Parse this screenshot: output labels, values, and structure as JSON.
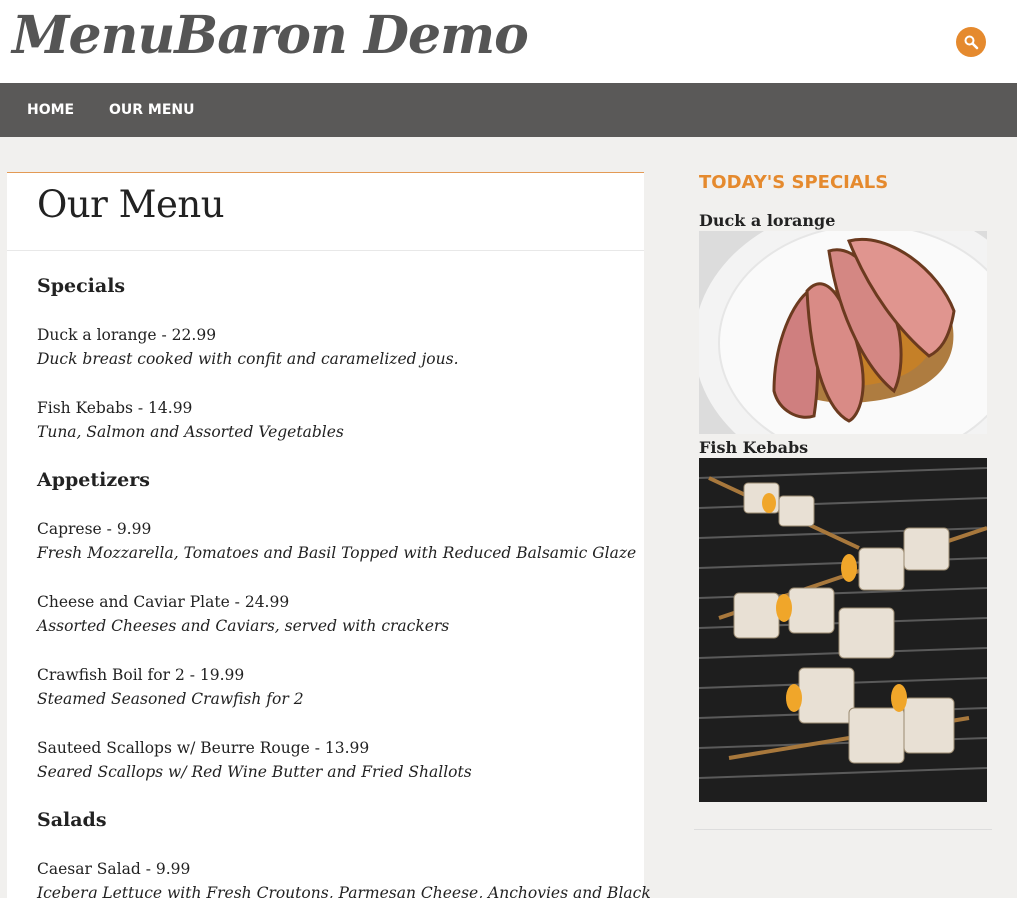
{
  "header": {
    "site_title": "MenuBaron Demo",
    "search_icon": "search-icon",
    "accent_color": "#e58a2e"
  },
  "nav": {
    "items": [
      {
        "label": "HOME"
      },
      {
        "label": "OUR MENU"
      }
    ]
  },
  "main": {
    "page_title": "Our Menu",
    "sections": [
      {
        "heading": "Specials",
        "items": [
          {
            "name": "Duck a lorange - 22.99",
            "description": "Duck breast cooked with confit and caramelized jous."
          },
          {
            "name": "Fish Kebabs - 14.99",
            "description": "Tuna, Salmon and Assorted Vegetables"
          }
        ]
      },
      {
        "heading": "Appetizers",
        "items": [
          {
            "name": "Caprese - 9.99",
            "description": "Fresh Mozzarella, Tomatoes and Basil Topped with Reduced Balsamic Glaze"
          },
          {
            "name": "Cheese and Caviar Plate - 24.99",
            "description": "Assorted Cheeses and Caviars, served with crackers"
          },
          {
            "name": "Crawfish Boil for 2 - 19.99",
            "description": "Steamed Seasoned Crawfish for 2"
          },
          {
            "name": "Sauteed Scallops w/ Beurre Rouge - 13.99",
            "description": "Seared Scallops w/ Red Wine Butter and Fried Shallots"
          }
        ]
      },
      {
        "heading": "Salads",
        "items": [
          {
            "name": "Caesar Salad - 9.99",
            "description": "Iceberg Lettuce with Fresh Croutons, Parmesan Cheese, Anchovies and Black"
          }
        ]
      }
    ]
  },
  "sidebar": {
    "heading": "TODAY'S SPECIALS",
    "specials": [
      {
        "title": "Duck a lorange",
        "image": "duck-photo"
      },
      {
        "title": "Fish Kebabs",
        "image": "fish-kebabs-photo"
      }
    ]
  }
}
